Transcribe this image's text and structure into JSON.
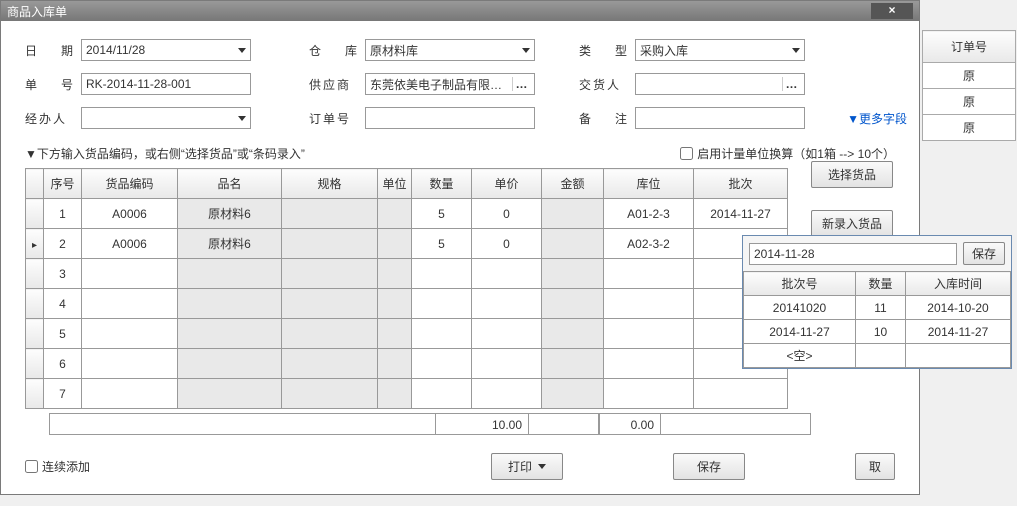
{
  "dialog": {
    "title": "商品入库单",
    "close": "×"
  },
  "form": {
    "date": {
      "label": "日　期",
      "value": "2014/11/28"
    },
    "warehouse": {
      "label": "仓　库",
      "value": "原材料库"
    },
    "type": {
      "label": "类　型",
      "value": "采购入库"
    },
    "docno": {
      "label": "单　号",
      "value": "RK-2014-11-28-001"
    },
    "supplier": {
      "label": "供应商",
      "value": "东莞依美电子制品有限公司……"
    },
    "delivery": {
      "label": "交货人",
      "value": ""
    },
    "handler": {
      "label": "经办人",
      "value": ""
    },
    "orderno": {
      "label": "订单号",
      "value": ""
    },
    "remark": {
      "label": "备　注",
      "value": ""
    },
    "more_fields": "▼更多字段"
  },
  "hint": {
    "text": "▼下方输入货品编码，或右侧“选择货品”或“条码录入”",
    "unit_conv": "启用计量单位换算（如1箱 --> 10个）"
  },
  "grid": {
    "headers": [
      "序号",
      "货品编码",
      "品名",
      "规格",
      "单位",
      "数量",
      "单价",
      "金额",
      "库位",
      "批次"
    ],
    "rows": [
      {
        "n": "1",
        "code": "A0006",
        "name": "原材料6",
        "spec": "",
        "unit": "",
        "qty": "5",
        "price": "0",
        "amount": "",
        "loc": "A01-2-3",
        "batch": "2014-11-27"
      },
      {
        "n": "2",
        "code": "A0006",
        "name": "原材料6",
        "spec": "",
        "unit": "",
        "qty": "5",
        "price": "0",
        "amount": "",
        "loc": "A02-3-2",
        "batch": ""
      },
      {
        "n": "3"
      },
      {
        "n": "4"
      },
      {
        "n": "5"
      },
      {
        "n": "6"
      },
      {
        "n": "7"
      }
    ],
    "totals": {
      "qty": "10.00",
      "amount": "0.00"
    }
  },
  "side": {
    "select_goods": "选择货品",
    "new_goods": "新录入货品"
  },
  "footer": {
    "continuous": "连续添加",
    "print": "打印",
    "save": "保存",
    "cancel": "取"
  },
  "bg": {
    "order_no": "订单号",
    "vals": [
      "原",
      "原",
      "原"
    ]
  },
  "popup": {
    "input": "2014-11-28",
    "save": "保存",
    "headers": [
      "批次号",
      "数量",
      "入库时间"
    ],
    "rows": [
      {
        "b": "20141020",
        "q": "11",
        "t": "2014-10-20"
      },
      {
        "b": "2014-11-27",
        "q": "10",
        "t": "2014-11-27"
      }
    ],
    "empty": "<空>"
  }
}
